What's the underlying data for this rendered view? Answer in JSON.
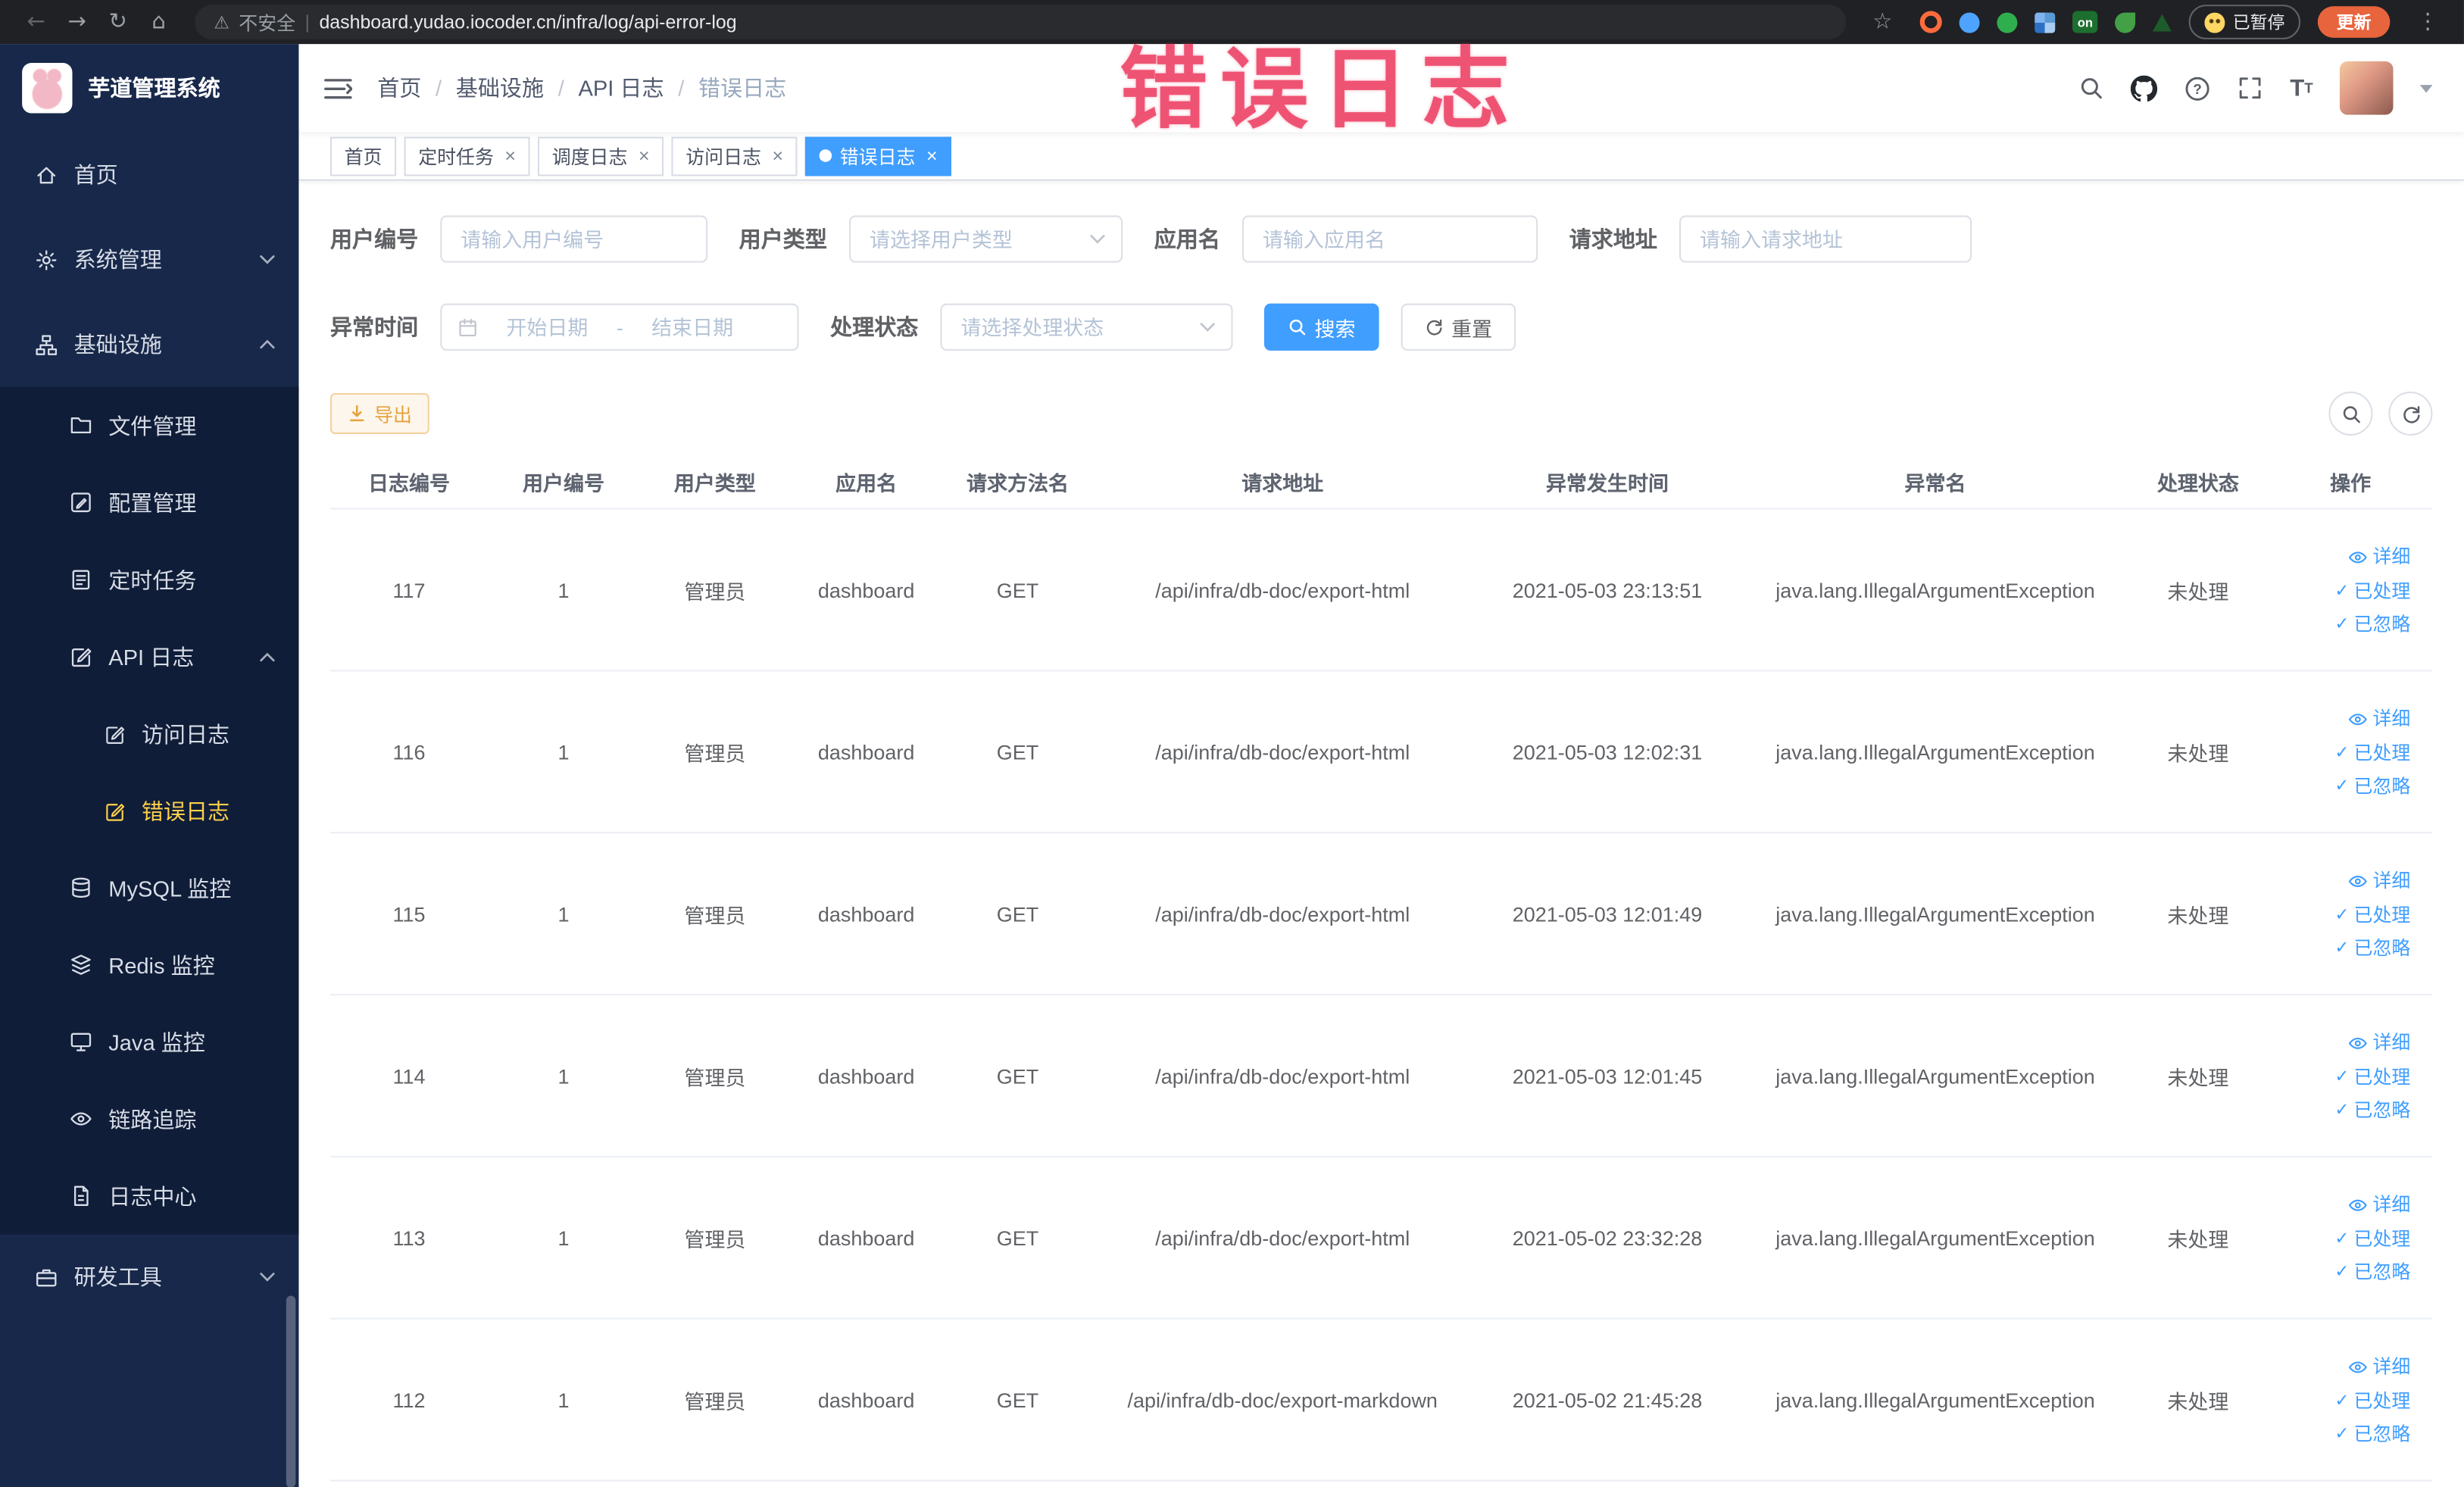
{
  "browser": {
    "security_label": "不安全",
    "url": "dashboard.yudao.iocoder.cn/infra/log/api-error-log",
    "divider": "|",
    "paused_label": "已暂停",
    "update_label": "更新",
    "extension_on_label": "on",
    "icons": {
      "back": "←",
      "forward": "→",
      "reload": "↻",
      "home": "⌂",
      "warning": "⚠",
      "star": "☆",
      "dots": "⋮"
    }
  },
  "annotation": {
    "text": "错误日志",
    "color": "#ee4568"
  },
  "sidebar": {
    "title": "芋道管理系统",
    "active_color": "#ffd04b",
    "items": [
      {
        "label": "首页",
        "icon": "home-icon"
      },
      {
        "label": "系统管理",
        "icon": "gear-icon",
        "chevron": "down"
      },
      {
        "label": "基础设施",
        "icon": "tree-icon",
        "chevron": "up"
      },
      {
        "label": "文件管理",
        "icon": "folder-icon"
      },
      {
        "label": "配置管理",
        "icon": "edit-square-icon"
      },
      {
        "label": "定时任务",
        "icon": "task-list-icon"
      },
      {
        "label": "API 日志",
        "icon": "edit-doc-icon",
        "chevron": "up"
      },
      {
        "label": "访问日志",
        "icon": "edit-doc-icon"
      },
      {
        "label": "错误日志",
        "icon": "edit-doc-icon",
        "active": true
      },
      {
        "label": "MySQL 监控",
        "icon": "database-icon"
      },
      {
        "label": "Redis 监控",
        "icon": "stack-icon"
      },
      {
        "label": "Java 监控",
        "icon": "monitor-icon"
      },
      {
        "label": "链路追踪",
        "icon": "eye-icon"
      },
      {
        "label": "日志中心",
        "icon": "file-text-icon"
      },
      {
        "label": "研发工具",
        "icon": "briefcase-icon",
        "chevron": "down"
      }
    ]
  },
  "navbar": {
    "icons": {
      "font_size_big": "T",
      "font_size_small": "T",
      "question_mark": "?"
    }
  },
  "breadcrumb": {
    "separator": "/",
    "items": [
      "首页",
      "基础设施",
      "API 日志",
      "错误日志"
    ]
  },
  "tabs": {
    "close_glyph": "×",
    "items": [
      {
        "label": "首页",
        "closable": false,
        "active": false
      },
      {
        "label": "定时任务",
        "closable": true,
        "active": false
      },
      {
        "label": "调度日志",
        "closable": true,
        "active": false
      },
      {
        "label": "访问日志",
        "closable": true,
        "active": false
      },
      {
        "label": "错误日志",
        "closable": true,
        "active": true
      }
    ]
  },
  "filters": {
    "user_id_label": "用户编号",
    "user_id_placeholder": "请输入用户编号",
    "user_type_label": "用户类型",
    "user_type_placeholder": "请选择用户类型",
    "app_name_label": "应用名",
    "app_name_placeholder": "请输入应用名",
    "request_url_label": "请求地址",
    "request_url_placeholder": "请输入请求地址",
    "exception_time_label": "异常时间",
    "start_date_placeholder": "开始日期",
    "date_separator": "-",
    "end_date_placeholder": "结束日期",
    "process_status_label": "处理状态",
    "process_status_placeholder": "请选择处理状态",
    "search_button": "搜索",
    "reset_button": "重置"
  },
  "toolbar": {
    "export_button": "导出"
  },
  "table": {
    "headers": [
      "日志编号",
      "用户编号",
      "用户类型",
      "应用名",
      "请求方法名",
      "请求地址",
      "异常发生时间",
      "异常名",
      "处理状态",
      "操作"
    ],
    "actions": {
      "detail": "详细",
      "processed": "已处理",
      "ignored": "已忽略",
      "check_glyph": "✓"
    },
    "rows": [
      {
        "id": "117",
        "user_id": "1",
        "user_type": "管理员",
        "app": "dashboard",
        "method": "GET",
        "url": "/api/infra/db-doc/export-html",
        "time": "2021-05-03 23:13:51",
        "exception": "java.lang.IllegalArgumentException",
        "status": "未处理"
      },
      {
        "id": "116",
        "user_id": "1",
        "user_type": "管理员",
        "app": "dashboard",
        "method": "GET",
        "url": "/api/infra/db-doc/export-html",
        "time": "2021-05-03 12:02:31",
        "exception": "java.lang.IllegalArgumentException",
        "status": "未处理"
      },
      {
        "id": "115",
        "user_id": "1",
        "user_type": "管理员",
        "app": "dashboard",
        "method": "GET",
        "url": "/api/infra/db-doc/export-html",
        "time": "2021-05-03 12:01:49",
        "exception": "java.lang.IllegalArgumentException",
        "status": "未处理"
      },
      {
        "id": "114",
        "user_id": "1",
        "user_type": "管理员",
        "app": "dashboard",
        "method": "GET",
        "url": "/api/infra/db-doc/export-html",
        "time": "2021-05-03 12:01:45",
        "exception": "java.lang.IllegalArgumentException",
        "status": "未处理"
      },
      {
        "id": "113",
        "user_id": "1",
        "user_type": "管理员",
        "app": "dashboard",
        "method": "GET",
        "url": "/api/infra/db-doc/export-html",
        "time": "2021-05-02 23:32:28",
        "exception": "java.lang.IllegalArgumentException",
        "status": "未处理"
      },
      {
        "id": "112",
        "user_id": "1",
        "user_type": "管理员",
        "app": "dashboard",
        "method": "GET",
        "url": "/api/infra/db-doc/export-markdown",
        "time": "2021-05-02 21:45:28",
        "exception": "java.lang.IllegalArgumentException",
        "status": "未处理"
      }
    ]
  }
}
